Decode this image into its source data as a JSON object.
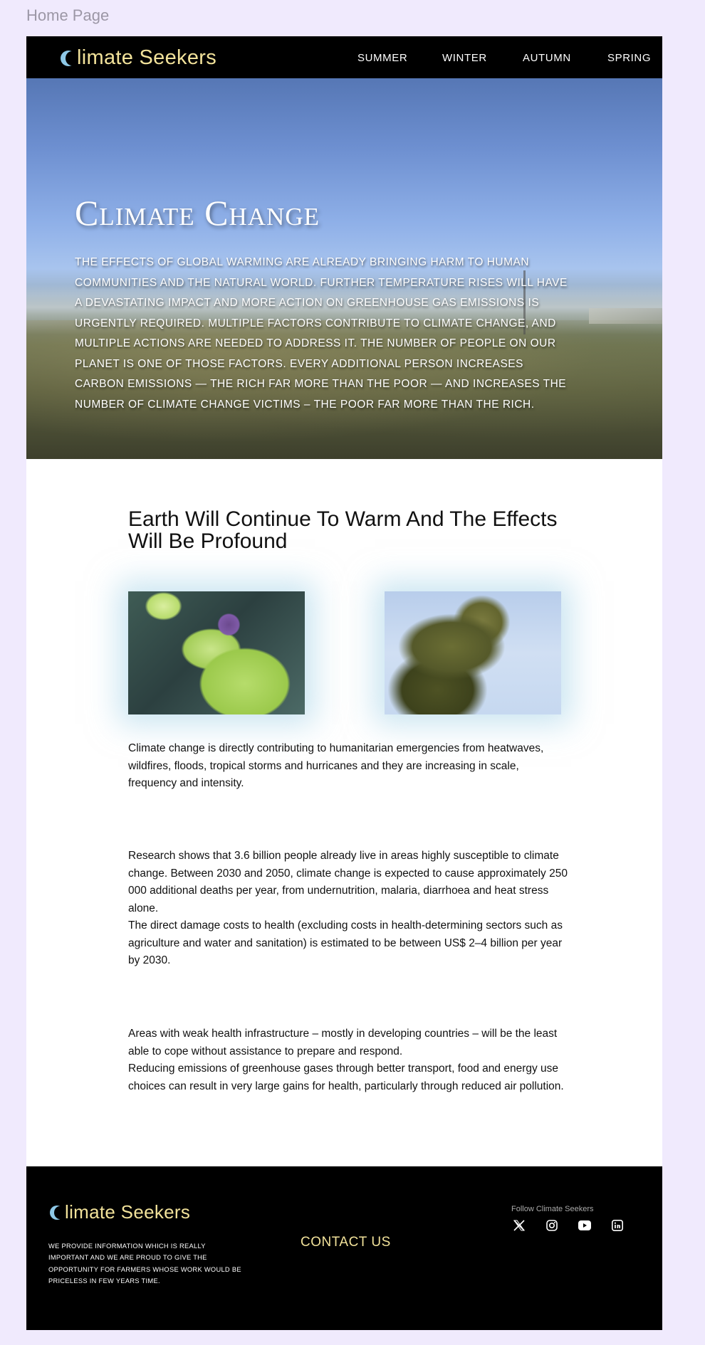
{
  "page_label": "Home Page",
  "header": {
    "logo": {
      "initial": "C",
      "rest": "limate Seekers",
      "accent_color": "#f2e29a",
      "moon_color": "#8ec9e8"
    },
    "nav": [
      {
        "label": "SUMMER"
      },
      {
        "label": "WINTER"
      },
      {
        "label": "AUTUMN"
      },
      {
        "label": "SPRING"
      }
    ]
  },
  "hero": {
    "title": "Climate Change",
    "text": "The effects of global warming are already bringing harm to human communities and the natural world. Further temperature rises will have a devastating impact and more action on greenhouse gas emissions is urgently required. Multiple factors contribute to climate change, and multiple actions are needed to address it. The number of people on our planet is one of those factors. Every additional person increases carbon emissions — the rich far more than the poor — and increases the number of climate change victims – the poor far more than the rich."
  },
  "main": {
    "heading": "Earth Will Continue To Warm And The Effects Will Be Profound",
    "images": [
      {
        "subject": "morning-glory-flower"
      },
      {
        "subject": "tree-against-sky"
      }
    ],
    "paragraphs": [
      "Climate change is directly contributing to humanitarian emergencies from heatwaves, wildfires, floods, tropical storms and hurricanes and they are increasing in scale, frequency and intensity.",
      "Research shows that 3.6 billion people already live in areas highly susceptible to climate change. Between 2030 and 2050, climate change is expected to cause approximately 250 000 additional deaths per year, from undernutrition, malaria, diarrhoea and heat stress alone.",
      "The direct damage costs to health (excluding costs in health-determining sectors such as agriculture and water and sanitation) is estimated to be between US$ 2–4 billion per year by 2030.",
      "Areas with weak health infrastructure – mostly in developing countries – will be the least able to cope without assistance to prepare and respond.",
      "Reducing emissions of greenhouse gases through better transport, food and energy use choices can result in very large gains for health, particularly through reduced air pollution."
    ]
  },
  "footer": {
    "logo": {
      "initial": "C",
      "rest": "limate Seekers"
    },
    "text": "We provide information which is really important and we are proud to give the opportunity for farmers whose work would be priceless in few years time.",
    "contact_label": "CONTACT US",
    "follow_label": "Follow Climate Seekers",
    "social": [
      {
        "icon": "x-twitter-icon"
      },
      {
        "icon": "instagram-icon"
      },
      {
        "icon": "youtube-icon"
      },
      {
        "icon": "linkedin-icon"
      }
    ]
  }
}
